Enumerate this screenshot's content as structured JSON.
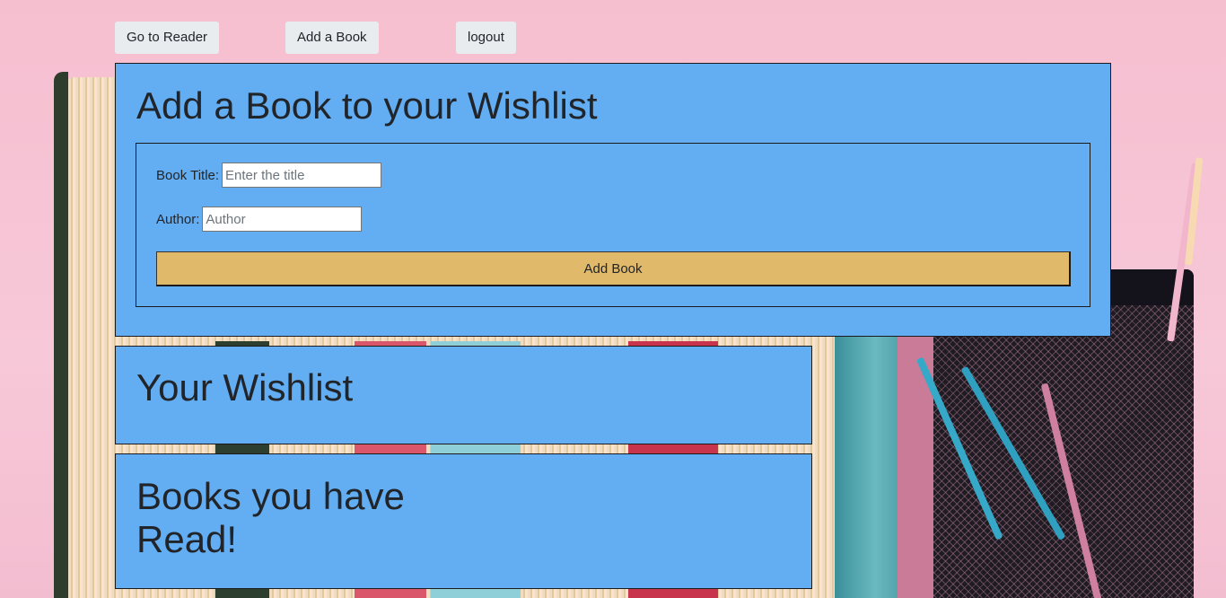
{
  "nav": {
    "reader_label": "Go to Reader",
    "add_book_label": "Add a Book",
    "logout_label": "logout"
  },
  "add_section": {
    "title": "Add a Book to your Wishlist",
    "title_field": {
      "label": "Book Title:",
      "value": "",
      "placeholder": "Enter the title"
    },
    "author_field": {
      "label": "Author:",
      "value": "",
      "placeholder": "Author"
    },
    "submit_label": "Add Book",
    "colors": {
      "panel": "#63adf2",
      "button": "#e1b96b"
    }
  },
  "wishlist_section": {
    "title": "Your Wishlist"
  },
  "read_section": {
    "title_line1": "Books you have",
    "title_line2": "Read!"
  }
}
